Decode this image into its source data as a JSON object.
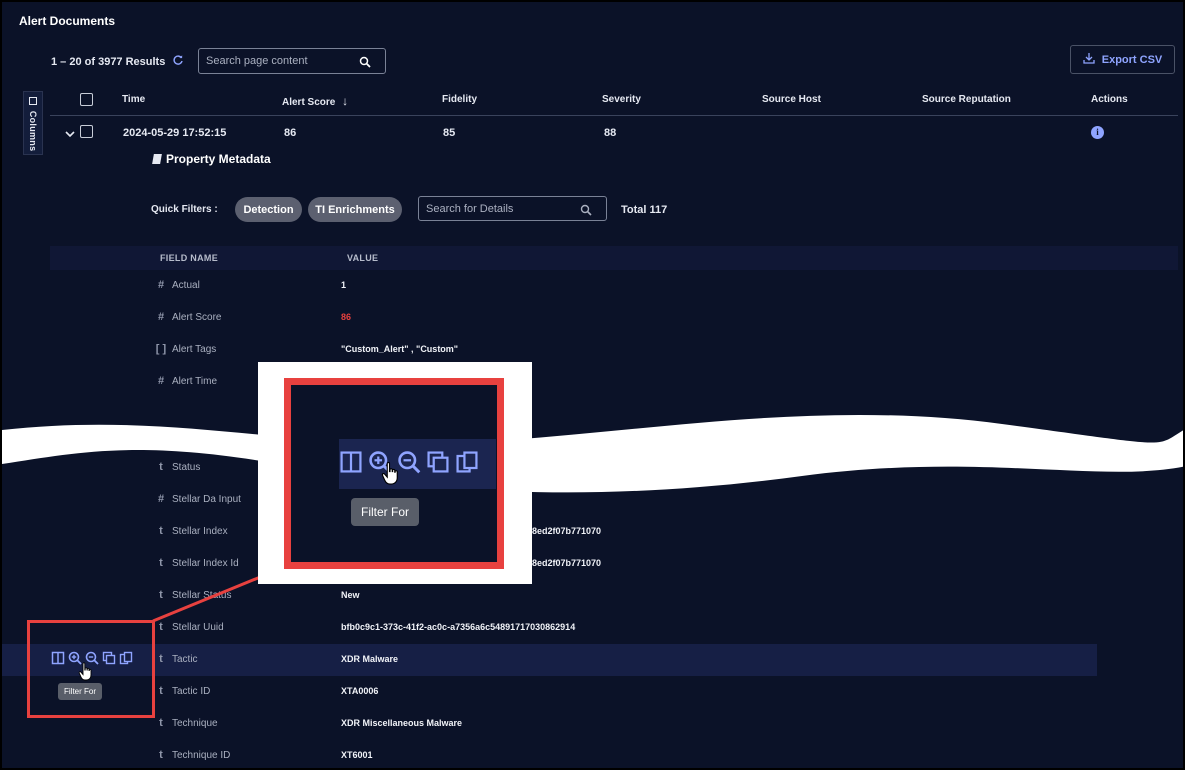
{
  "app": {
    "title": "Alert Documents"
  },
  "toolbar": {
    "results": "1 – 20 of 3977 Results",
    "search_placeholder": "Search page content",
    "export_label": "Export CSV",
    "columns_label": "Columns"
  },
  "table": {
    "headers": [
      "Time",
      "Alert Score",
      "Fidelity",
      "Severity",
      "Source Host",
      "Source Reputation",
      "Actions"
    ],
    "sort_indicator": "↓",
    "row": {
      "time": "2024-05-29 17:52:15",
      "alert_score": "86",
      "fidelity": "85",
      "severity": "88"
    }
  },
  "metadata": {
    "title": "Property Metadata",
    "quick_filters_label": "Quick Filters :",
    "filters": [
      "Detection",
      "TI Enrichments"
    ],
    "details_placeholder": "Search for Details",
    "total": "Total 117",
    "col_field": "FIELD NAME",
    "col_value": "VALUE",
    "fields": [
      {
        "type": "#",
        "name": "Actual",
        "value": "1"
      },
      {
        "type": "#",
        "name": "Alert Score",
        "value": "86",
        "color": "#e8413f"
      },
      {
        "type": "[ ]",
        "name": "Alert Tags",
        "value": "\"Custom_Alert\" , \"Custom\""
      },
      {
        "type": "#",
        "name": "Alert Time",
        "value": ""
      },
      {
        "type": "t",
        "name": "Status",
        "value": ""
      },
      {
        "type": "#",
        "name": "Stellar Da Input",
        "value": ""
      },
      {
        "type": "t",
        "name": "Stellar Index",
        "value": "8ed2f07b771070"
      },
      {
        "type": "t",
        "name": "Stellar Index Id",
        "value": "8ed2f07b771070"
      },
      {
        "type": "t",
        "name": "Stellar Status",
        "value": "New"
      },
      {
        "type": "t",
        "name": "Stellar Uuid",
        "value": "bfb0c9c1-373c-41f2-ac0c-a7356a6c54891717030862914"
      },
      {
        "type": "t",
        "name": "Tactic",
        "value": "XDR Malware"
      },
      {
        "type": "t",
        "name": "Tactic ID",
        "value": "XTA0006"
      },
      {
        "type": "t",
        "name": "Technique",
        "value": "XDR Miscellaneous Malware"
      },
      {
        "type": "t",
        "name": "Technique ID",
        "value": "XT6001"
      }
    ]
  },
  "row_actions": {
    "tooltip": "Filter For",
    "icons": [
      "split-view-icon",
      "zoom-in-icon",
      "zoom-out-icon",
      "copy-icon",
      "copy-alt-icon"
    ]
  },
  "colors": {
    "background": "#0b1228",
    "accent": "#8fa4ff",
    "highlight": "#e8413f"
  }
}
